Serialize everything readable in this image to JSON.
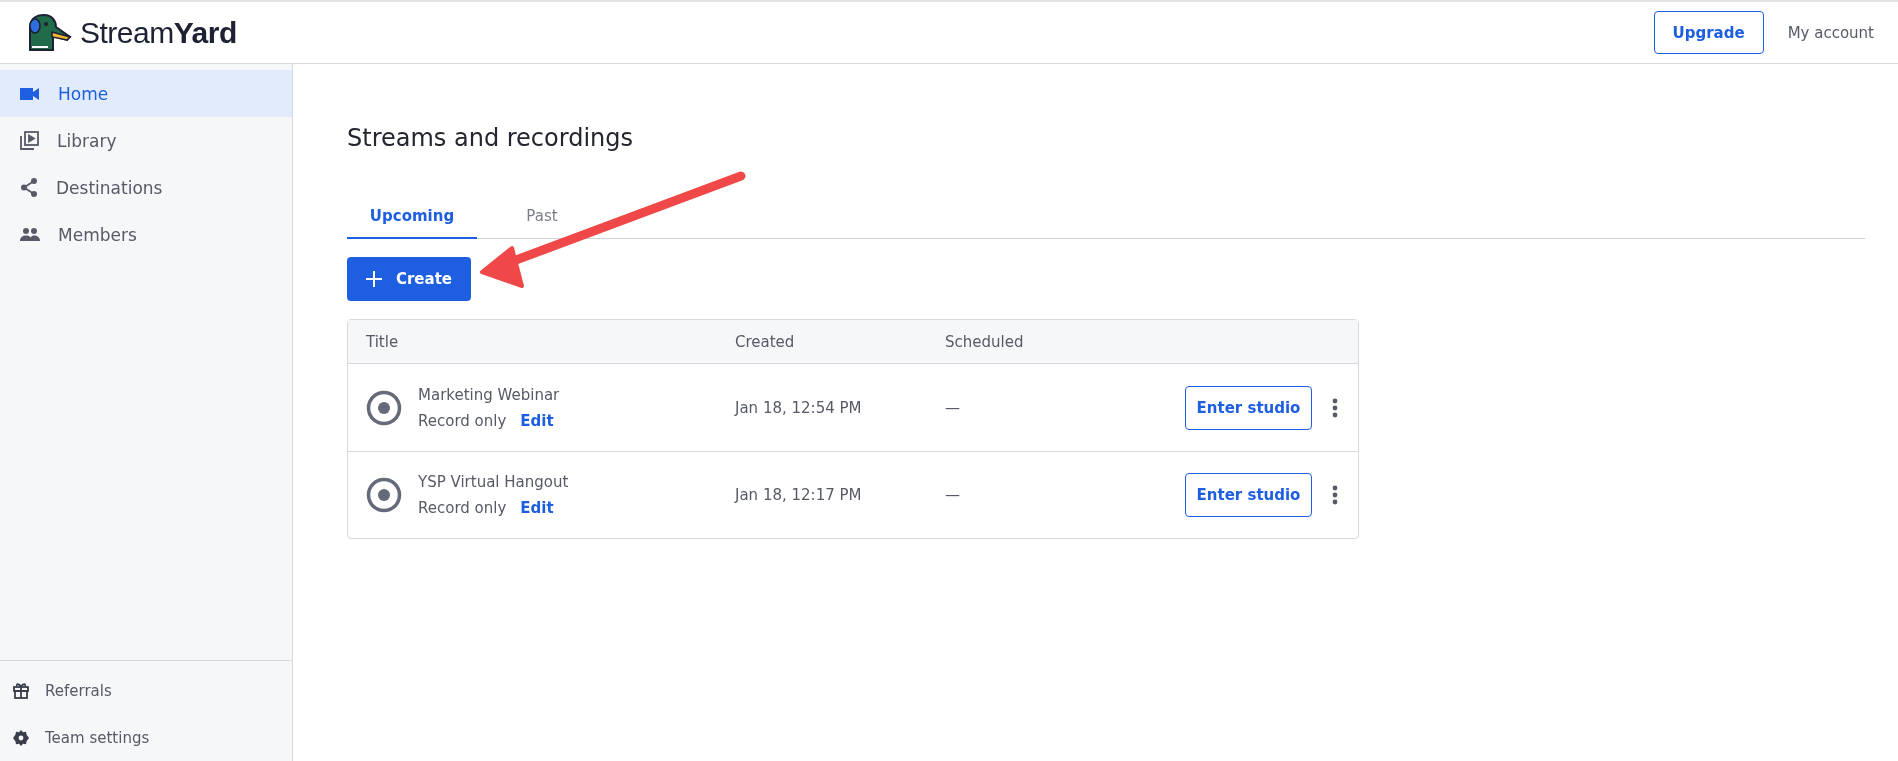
{
  "header": {
    "logo": "Stream**Yard**",
    "upgrade": "Upgrade",
    "account": "My account"
  },
  "sidebar": {
    "items": [
      {
        "label": "Home",
        "selected": true
      },
      {
        "label": "Library",
        "selected": false
      },
      {
        "label": "Destinations",
        "selected": false
      },
      {
        "label": "Members",
        "selected": false
      }
    ],
    "bottom_items": [
      {
        "label": "Referrals"
      },
      {
        "label": "Team settings"
      }
    ]
  },
  "page": {
    "title": "Streams and recordings",
    "tabs": [
      {
        "label": "Upcoming",
        "selected": true
      },
      {
        "label": "Past",
        "selected": false
      }
    ],
    "create_button": "Create",
    "table": {
      "columns": [
        "Title",
        "Created",
        "Scheduled"
      ],
      "rows": [
        {
          "title": "Marketing Webinar",
          "type": "Record only",
          "edit": "Edit",
          "created": "Jan 18, 12:54 PM",
          "scheduled": "—",
          "action": "Enter studio"
        },
        {
          "title": "YSP Virtual Hangout",
          "type": "Record only",
          "edit": "Edit",
          "created": "Jan 18, 12:17 PM",
          "scheduled": "—",
          "action": "Enter studio"
        }
      ]
    }
  }
}
